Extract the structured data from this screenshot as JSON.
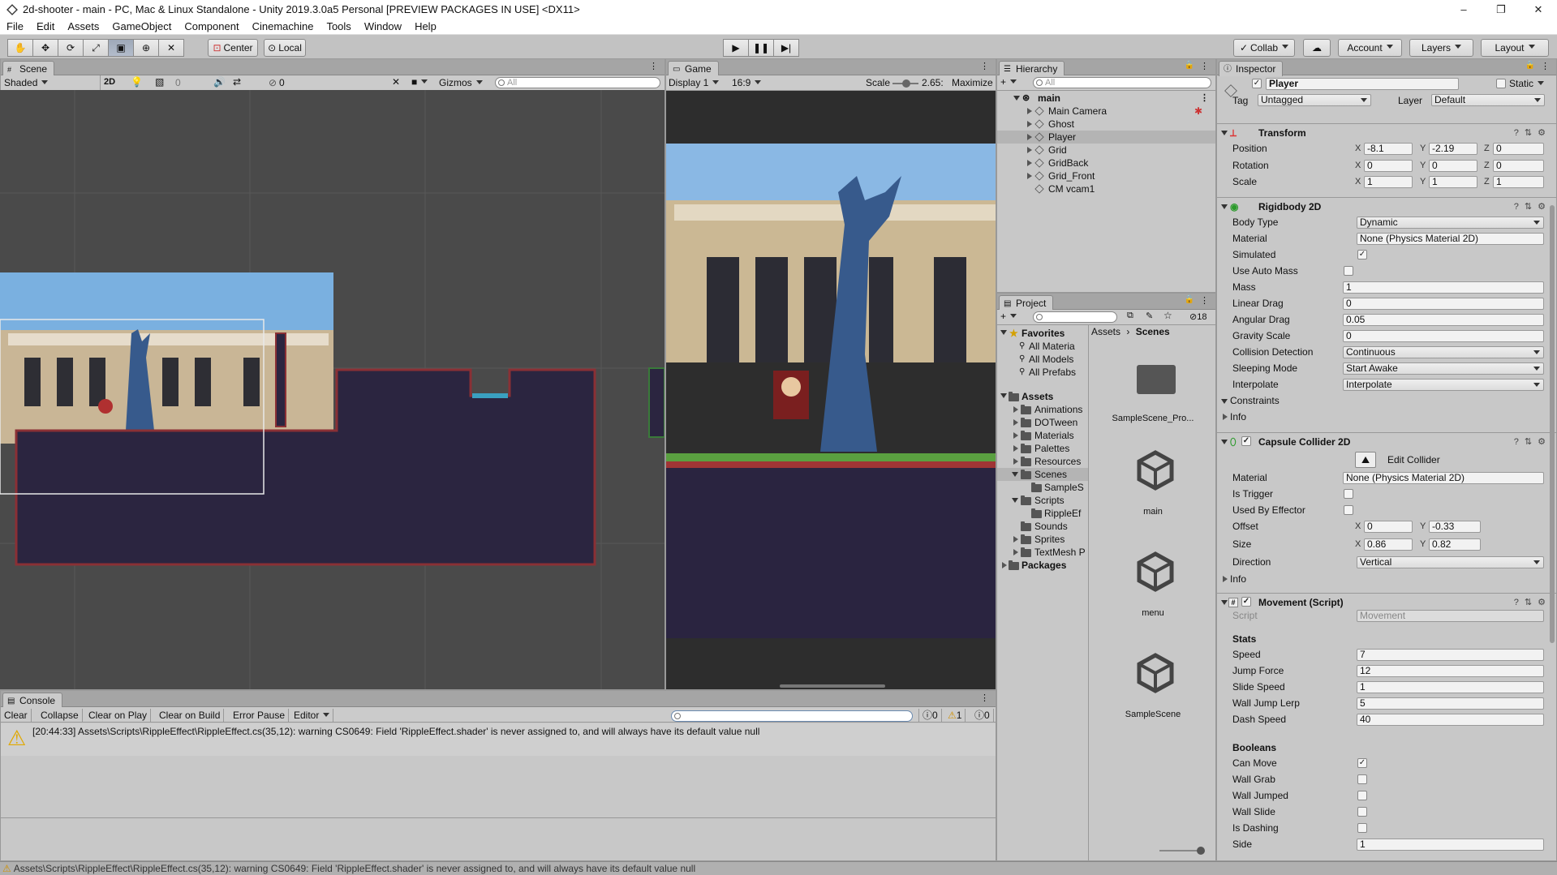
{
  "window": {
    "title": "2d-shooter - main - PC, Mac & Linux Standalone - Unity 2019.3.0a5 Personal [PREVIEW PACKAGES IN USE] <DX11>",
    "minimize": "–",
    "maximize": "❐",
    "close": "✕"
  },
  "menu": [
    "File",
    "Edit",
    "Assets",
    "GameObject",
    "Component",
    "Cinemachine",
    "Tools",
    "Window",
    "Help"
  ],
  "toolbar": {
    "pivot": "Center",
    "space": "Local",
    "collab": "Collab",
    "account": "Account",
    "layers": "Layers",
    "layout": "Layout"
  },
  "scene": {
    "tab": "Scene",
    "shading": "Shaded",
    "mode2d": "2D",
    "fx_count": "0",
    "gizmos": "Gizmos",
    "search_placeholder": "All",
    "hidden_count": "0"
  },
  "game": {
    "tab": "Game",
    "display": "Display 1",
    "aspect": "16:9",
    "scale_label": "Scale",
    "scale_value": "2.65:",
    "maximize": "Maximize"
  },
  "hierarchy": {
    "tab": "Hierarchy",
    "search_placeholder": "All",
    "scene_name": "main",
    "items": [
      {
        "label": "Main Camera"
      },
      {
        "label": "Ghost"
      },
      {
        "label": "Player"
      },
      {
        "label": "Grid"
      },
      {
        "label": "GridBack"
      },
      {
        "label": "Grid_Front"
      },
      {
        "label": "CM vcam1"
      }
    ]
  },
  "project": {
    "tab": "Project",
    "count": "18",
    "favorites": "Favorites",
    "fav_items": [
      "All Materia",
      "All Models",
      "All Prefabs"
    ],
    "assets": "Assets",
    "asset_folders": [
      "Animations",
      "DOTween",
      "Materials",
      "Palettes",
      "Resources",
      "Scenes",
      "SampleS",
      "Scripts",
      "RippleEf",
      "Sounds",
      "Sprites",
      "TextMesh P"
    ],
    "packages": "Packages",
    "breadcrumb": [
      "Assets",
      "Scenes"
    ],
    "files": [
      {
        "name": "SampleScene_Pro..."
      },
      {
        "name": "main"
      },
      {
        "name": "menu"
      },
      {
        "name": "SampleScene"
      }
    ]
  },
  "inspector": {
    "tab": "Inspector",
    "object_name": "Player",
    "static": "Static",
    "tag_label": "Tag",
    "tag": "Untagged",
    "layer_label": "Layer",
    "layer": "Default",
    "transform": {
      "title": "Transform",
      "position_label": "Position",
      "rotation_label": "Rotation",
      "scale_label": "Scale",
      "position": [
        "-8.1",
        "-2.19",
        "0"
      ],
      "rotation": [
        "0",
        "0",
        "0"
      ],
      "scale": [
        "1",
        "1",
        "1"
      ]
    },
    "rigidbody": {
      "title": "Rigidbody 2D",
      "body_type_label": "Body Type",
      "body_type": "Dynamic",
      "material_label": "Material",
      "material": "None (Physics Material 2D)",
      "simulated_label": "Simulated",
      "auto_mass_label": "Use Auto Mass",
      "mass_label": "Mass",
      "mass": "1",
      "linear_drag_label": "Linear Drag",
      "linear_drag": "0",
      "angular_drag_label": "Angular Drag",
      "angular_drag": "0.05",
      "gravity_label": "Gravity Scale",
      "gravity": "0",
      "collision_label": "Collision Detection",
      "collision": "Continuous",
      "sleeping_label": "Sleeping Mode",
      "sleeping": "Start Awake",
      "interpolate_label": "Interpolate",
      "interpolate": "Interpolate",
      "constraints": "Constraints",
      "info": "Info"
    },
    "collider": {
      "title": "Capsule Collider 2D",
      "edit": "Edit Collider",
      "material_label": "Material",
      "material": "None (Physics Material 2D)",
      "trigger_label": "Is Trigger",
      "effector_label": "Used By Effector",
      "offset_label": "Offset",
      "offset": [
        "0",
        "-0.33"
      ],
      "size_label": "Size",
      "size": [
        "0.86",
        "0.82"
      ],
      "direction_label": "Direction",
      "direction": "Vertical",
      "info": "Info"
    },
    "movement": {
      "title": "Movement (Script)",
      "script_label": "Script",
      "script": "Movement",
      "stats": "Stats",
      "speed_label": "Speed",
      "speed": "7",
      "jump_label": "Jump Force",
      "jump": "12",
      "slide_label": "Slide Speed",
      "slide": "1",
      "walljump_label": "Wall Jump Lerp",
      "walljump": "5",
      "dash_label": "Dash Speed",
      "dash": "40",
      "booleans": "Booleans",
      "canmove_label": "Can Move",
      "wallgrab_label": "Wall Grab",
      "walljumped_label": "Wall Jumped",
      "wallslide_label": "Wall Slide",
      "dashing_label": "Is Dashing",
      "side_label": "Side",
      "side": "1"
    },
    "axis": {
      "x": "X",
      "y": "Y",
      "z": "Z"
    },
    "check": "✓"
  },
  "console": {
    "tab": "Console",
    "clear": "Clear",
    "collapse": "Collapse",
    "clear_on_play": "Clear on Play",
    "clear_on_build": "Clear on Build",
    "error_pause": "Error Pause",
    "editor": "Editor",
    "info_count": "0",
    "warn_count": "1",
    "error_count": "0",
    "message": "[20:44:33] Assets\\Scripts\\RippleEffect\\RippleEffect.cs(35,12): warning CS0649: Field 'RippleEffect.shader' is never assigned to, and will always have its default value null"
  },
  "status": {
    "message": "Assets\\Scripts\\RippleEffect\\RippleEffect.cs(35,12): warning CS0649: Field 'RippleEffect.shader' is never assigned to, and will always have its default value null"
  }
}
